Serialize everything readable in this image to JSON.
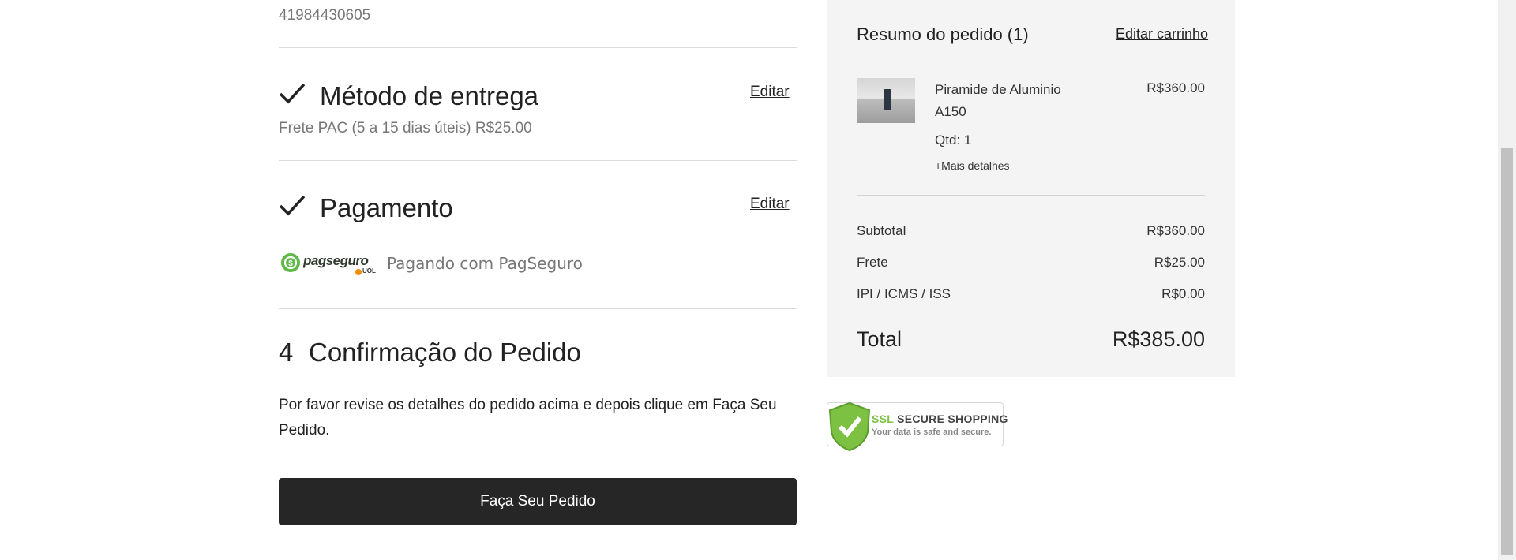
{
  "contact": {
    "phone": "41984430605"
  },
  "delivery": {
    "title": "Método de entrega",
    "edit_label": "Editar",
    "selected": "Frete PAC (5 a 15 dias úteis) R$25.00"
  },
  "payment": {
    "title": "Pagamento",
    "edit_label": "Editar",
    "logo_text": "pagseguro",
    "logo_sub": "UOL",
    "method_text": "Pagando com PagSeguro"
  },
  "confirmation": {
    "step_number": "4",
    "title": "Confirmação do Pedido",
    "instructions": "Por favor revise os detalhes do pedido acima e depois clique em Faça Seu Pedido.",
    "button_label": "Faça Seu Pedido"
  },
  "summary": {
    "title": "Resumo do pedido (1)",
    "edit_cart_label": "Editar carrinho",
    "item": {
      "name": "Piramide de Aluminio A150",
      "price": "R$360.00",
      "qty": "Qtd: 1",
      "more_details": "+Mais detalhes"
    },
    "rows": [
      {
        "label": "Subtotal",
        "value": "R$360.00"
      },
      {
        "label": "Frete",
        "value": "R$25.00"
      },
      {
        "label": "IPI / ICMS / ISS",
        "value": "R$0.00"
      }
    ],
    "total_label": "Total",
    "total_value": "R$385.00"
  },
  "ssl_badge": {
    "line1_a": "SSL",
    "line1_b": "SECURE SHOPPING",
    "line2": "Your data is safe and secure."
  },
  "colors": {
    "button_bg": "#262626",
    "panel_bg": "#f4f4f4",
    "pagseguro_green": "#5fb946",
    "ssl_green": "#7cc142"
  }
}
